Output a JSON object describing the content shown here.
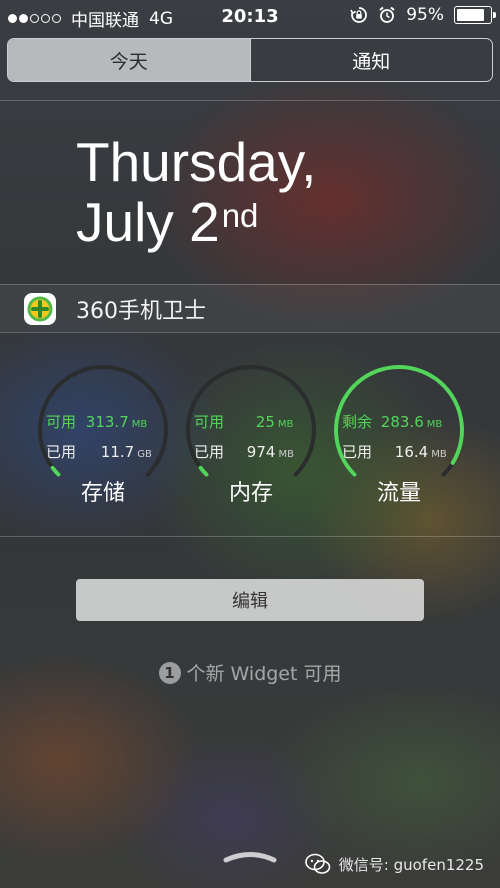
{
  "status": {
    "carrier": "中国联通",
    "network": "4G",
    "time": "20:13",
    "battery_percent_label": "95%",
    "battery_level": 0.95,
    "signal_bars_filled": 2,
    "signal_bars_total": 5
  },
  "tabs": [
    {
      "label": "今天",
      "selected": true
    },
    {
      "label": "通知",
      "selected": false
    }
  ],
  "date": {
    "line1": "Thursday,",
    "line2": "July 2",
    "suffix": "nd"
  },
  "widget": {
    "title": "360手机卫士",
    "icon": "360-security-icon",
    "gauges": [
      {
        "name": "存储",
        "row1_label": "可用",
        "row1_value": "313.7",
        "row1_unit": "MB",
        "row2_label": "已用",
        "row2_value": "11.7",
        "row2_unit": "GB",
        "fill_fraction": 0.03
      },
      {
        "name": "内存",
        "row1_label": "可用",
        "row1_value": "25",
        "row1_unit": "MB",
        "row2_label": "已用",
        "row2_value": "974",
        "row2_unit": "MB",
        "fill_fraction": 0.03
      },
      {
        "name": "流量",
        "row1_label": "剩余",
        "row1_value": "283.6",
        "row1_unit": "MB",
        "row2_label": "已用",
        "row2_value": "16.4",
        "row2_unit": "MB",
        "fill_fraction": 0.95
      }
    ]
  },
  "edit_button": {
    "label": "编辑"
  },
  "new_widgets": {
    "count": "1",
    "text": "个新 Widget 可用"
  },
  "watermark": {
    "text": "微信号: guofen1225",
    "icon": "wechat-icon"
  },
  "colors": {
    "accent_green": "#53d45a",
    "track": "#2a2c2e"
  }
}
